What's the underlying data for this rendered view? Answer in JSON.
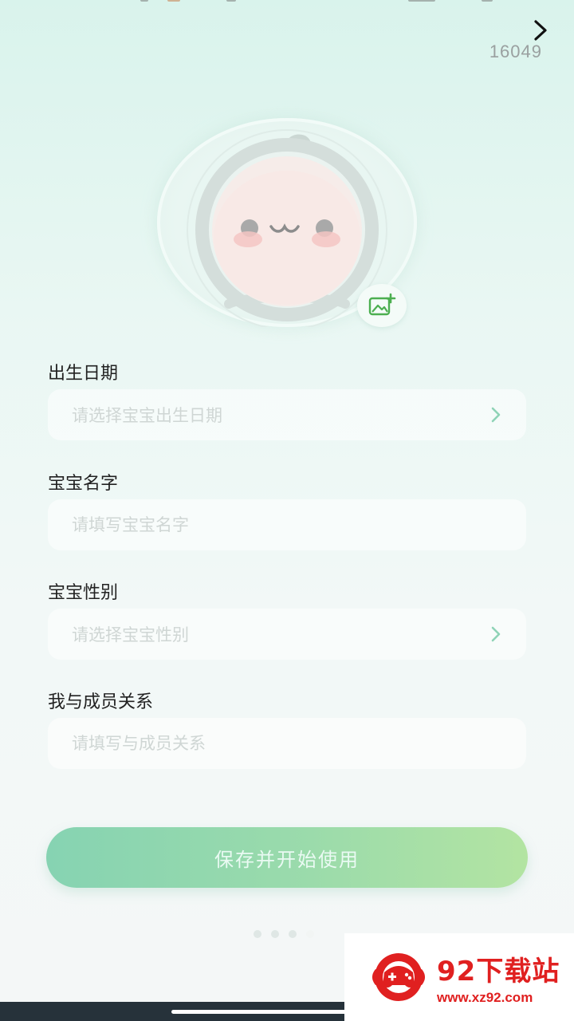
{
  "header": {
    "counter": "16049",
    "next_icon": "chevron-right-icon"
  },
  "avatar": {
    "photo_icon": "add-photo-icon"
  },
  "form": {
    "birth_date": {
      "label": "出生日期",
      "placeholder": "请选择宝宝出生日期"
    },
    "baby_name": {
      "label": "宝宝名字",
      "placeholder": "请填写宝宝名字"
    },
    "baby_gender": {
      "label": "宝宝性别",
      "placeholder": "请选择宝宝性别"
    },
    "relationship": {
      "label": "我与成员关系",
      "placeholder": "请填写与成员关系"
    }
  },
  "actions": {
    "save_label": "保存并开始使用"
  },
  "pager": {
    "total": 4,
    "active_index": 3
  },
  "watermark": {
    "title": "92下载站",
    "url": "www.xz92.com"
  },
  "colors": {
    "accent_start": "#86d3b2",
    "accent_end": "#b3e4a2",
    "chevron": "#8fd3b6",
    "photo_icon": "#4caf50",
    "watermark_red": "#e02020"
  }
}
